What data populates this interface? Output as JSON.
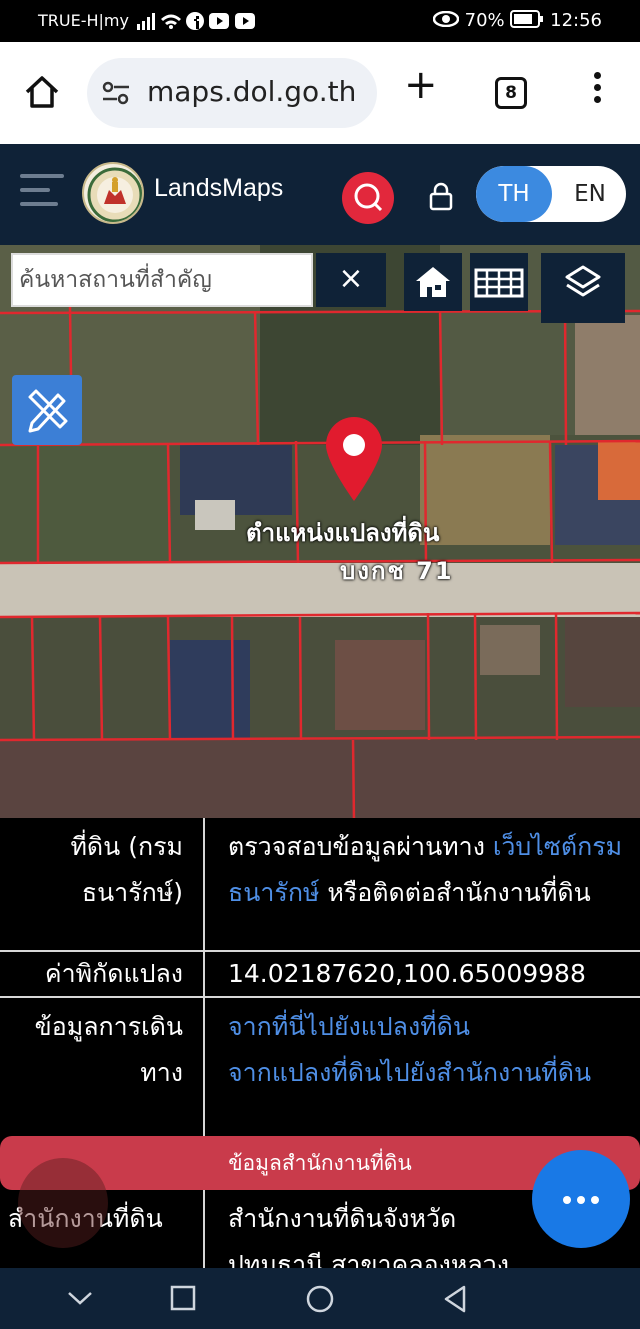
{
  "status_bar": {
    "carrier": "TRUE-H|my",
    "signal_icons": "signal-wifi-facebook-youtube-youtube",
    "battery": "70%",
    "time": "12:56"
  },
  "browser": {
    "url": "maps.dol.go.th",
    "tab_count": "8"
  },
  "header": {
    "brand": "LandsMaps",
    "lang_th": "TH",
    "lang_en": "EN"
  },
  "map": {
    "search_placeholder": "ค้นหาสถานที่สำคัญ",
    "clear_label": "×",
    "parcel_label": "ตำแหน่งแปลงที่ดิน",
    "parcel_code": "บงกช 71"
  },
  "info": {
    "row1_key_line1": "ที่ดิน (กรม",
    "row1_key_line2": "ธนารักษ์)",
    "row1_value_prefix": "ตรวจสอบข้อมูลผ่านทาง ",
    "row1_link": "เว็บไซต์กรมธนารักษ์",
    "row1_value_suffix": " หรือติดต่อสำนักงานที่ดิน",
    "row2_key": "ค่าพิกัดแปลง",
    "row2_value": "14.02187620,100.65009988",
    "row3_key_line1": "ข้อมูลการเดิน",
    "row3_key_line2": "ทาง",
    "row3_link1": "จากที่นี่ไปยังแปลงที่ดิน",
    "row3_link2": "จากแปลงที่ดินไปยังสำนักงานที่ดิน",
    "banner": "ข้อมูลสำนักงานที่ดิน",
    "row4_key": "สำนักงานที่ดิน",
    "row4_value": "สำนักงานที่ดินจังหวัดปทุมธานี สาขาคลองหลวง"
  },
  "colors": {
    "header_bg": "#0f2237",
    "accent_red": "#e2283c",
    "lang_active": "#3c8ae0",
    "link_blue": "#4f8fe6",
    "fab_blue": "#1979e6",
    "banner_red": "#c93b4b"
  }
}
